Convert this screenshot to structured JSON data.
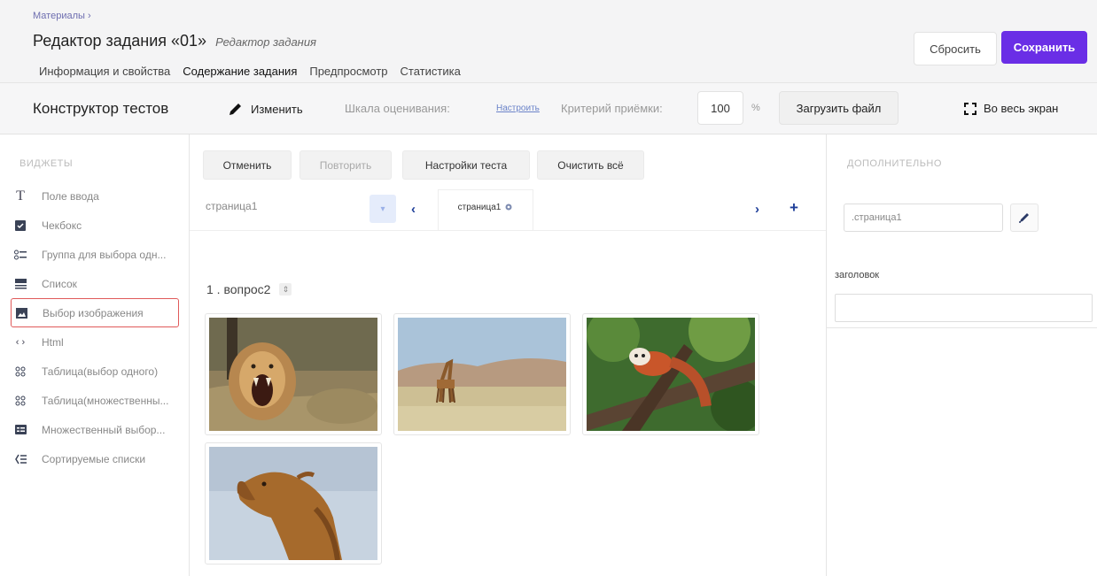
{
  "header": {
    "breadcrumb": "Материалы ›",
    "title": "Редактор задания «01»",
    "subtitle": "Редактор задания",
    "tabs": [
      {
        "label": "Информация и свойства"
      },
      {
        "label": "Содержание задания"
      },
      {
        "label": "Предпросмотр"
      },
      {
        "label": "Статистика"
      }
    ],
    "reset_label": "Сбросить",
    "save_label": "Сохранить",
    "accent_color": "#6a2ee6"
  },
  "toolbar": {
    "title": "Конструктор тестов",
    "edit_label": "Изменить",
    "scale_label": "Шкала оценивания:",
    "configure_link": "Настроить",
    "criterion_label": "Критерий приёмки:",
    "criterion_value": "100",
    "percent": "%",
    "upload_label": "Загрузить файл",
    "fullscreen_label": "Во весь экран"
  },
  "sidebar": {
    "heading": "ВИДЖЕТЫ",
    "items": [
      {
        "label": "Поле ввода",
        "icon": "text-icon"
      },
      {
        "label": "Чекбокс",
        "icon": "checkbox-icon"
      },
      {
        "label": "Группа для выбора одн...",
        "icon": "radio-group-icon"
      },
      {
        "label": "Список",
        "icon": "dropdown-list-icon"
      },
      {
        "label": "Выбор изображения",
        "icon": "image-picker-icon"
      },
      {
        "label": "Html",
        "icon": "code-icon"
      },
      {
        "label": "Таблица(выбор одного)",
        "icon": "matrix-single-icon"
      },
      {
        "label": "Таблица(множественны...",
        "icon": "matrix-multi-icon"
      },
      {
        "label": "Множественный выбор...",
        "icon": "multiple-text-icon"
      },
      {
        "label": "Сортируемые списки",
        "icon": "ranking-icon"
      }
    ]
  },
  "canvas": {
    "undo_label": "Отменить",
    "redo_label": "Повторить",
    "settings_label": "Настройки теста",
    "clear_label": "Очистить всё",
    "page_select_value": "страница1",
    "page_tab_label": "страница1",
    "question_title": "1 .  вопрос2",
    "images": [
      {
        "name": "lion"
      },
      {
        "name": "giraffe"
      },
      {
        "name": "red-panda"
      },
      {
        "name": "camel"
      }
    ]
  },
  "rpanel": {
    "heading": "ДОПОЛНИТЕЛЬНО",
    "selector_value": ".страница1",
    "title_label": "заголовок",
    "title_value": ""
  }
}
